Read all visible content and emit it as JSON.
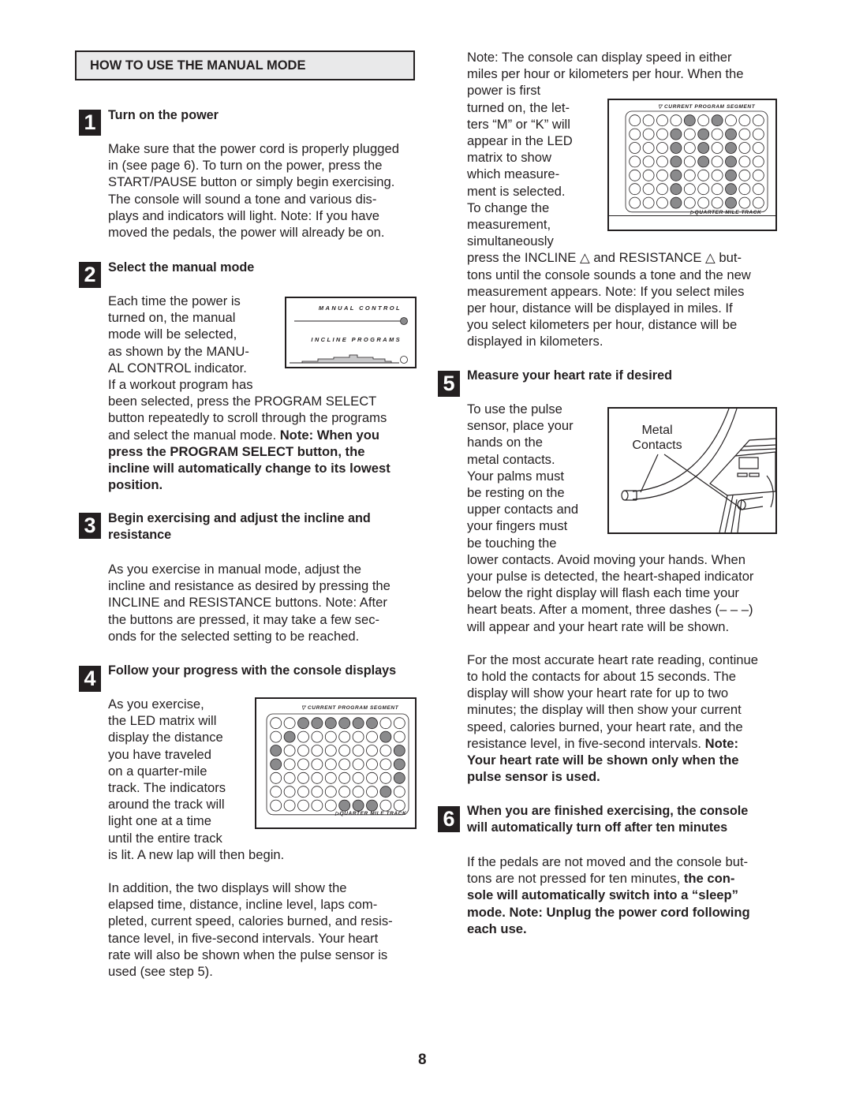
{
  "section": {
    "title": "HOW TO USE THE MANUAL MODE"
  },
  "steps": [
    {
      "number": "1",
      "heading": "Turn on the power",
      "body": [
        "Make sure that the power cord is properly plugged",
        "in (see page 6). To turn on the power, press the",
        "START/PAUSE button or simply begin exercising.",
        "The console will sound a tone and various dis-",
        "plays and indicators will light. Note: If you have",
        "moved the pedals, the power will already be on."
      ]
    },
    {
      "number": "2",
      "heading": "Select the manual mode",
      "body_wrapped": [
        "Each time the power is",
        "turned on, the manual",
        "mode will be selected,",
        "as shown by the MANU-",
        "AL CONTROL indicator.",
        "If a workout program has"
      ],
      "body": [
        "been selected, press the PROGRAM SELECT",
        "button repeatedly to scroll through the programs"
      ],
      "body_mixed_normal": "and select the manual mode. ",
      "body_mixed_bold": "Note: When you",
      "body_bold": [
        "press the PROGRAM SELECT button, the",
        "incline will automatically change to its lowest",
        "position."
      ],
      "figure": {
        "label_top": "MANUAL CONTROL",
        "label_bottom": "INCLINE PROGRAMS",
        "manual_control_lit": true,
        "incline_programs_lit": false
      }
    },
    {
      "number": "3",
      "heading": [
        "Begin exercising and adjust the incline and",
        "resistance"
      ],
      "body": [
        "As you exercise in manual mode, adjust the",
        "incline and resistance as desired by pressing the",
        "INCLINE and RESISTANCE buttons. Note: After",
        "the buttons are pressed, it may take a few sec-",
        "onds for the selected setting to be reached."
      ]
    },
    {
      "number": "4",
      "heading": "Follow your progress with the console displays",
      "body_wrapped": [
        "As you exercise,",
        "the LED matrix will",
        "display the distance",
        "you have traveled",
        "on a quarter-mile",
        "track. The indicators",
        "around the track will",
        "light one at a time",
        "until the entire track"
      ],
      "body_after": "is lit. A new lap will then begin.",
      "body2": [
        "In addition, the two displays will show the",
        "elapsed time, distance, incline level, laps com-",
        "pleted, current speed, calories burned, and resis-",
        "tance level, in five-second intervals. Your heart",
        "rate will also be shown when the pulse sensor is",
        "used (see step 5)."
      ],
      "figure": {
        "label_top": "CURRENT PROGRAM SEGMENT",
        "label_bottom": "QUARTER MILE TRACK",
        "matrix": [
          [
            0,
            0,
            1,
            1,
            1,
            1,
            1,
            1,
            0,
            0
          ],
          [
            0,
            1,
            0,
            0,
            0,
            0,
            0,
            0,
            1,
            0
          ],
          [
            1,
            0,
            0,
            0,
            0,
            0,
            0,
            0,
            0,
            1
          ],
          [
            1,
            0,
            0,
            0,
            0,
            0,
            0,
            0,
            0,
            1
          ],
          [
            0,
            0,
            0,
            0,
            0,
            0,
            0,
            0,
            0,
            1
          ],
          [
            0,
            0,
            0,
            0,
            0,
            0,
            0,
            0,
            1,
            0
          ],
          [
            0,
            0,
            0,
            0,
            0,
            1,
            1,
            1,
            0,
            0
          ]
        ]
      }
    },
    {
      "number": "5",
      "heading": "Measure your heart rate if desired",
      "body_wrapped": [
        "To use the pulse",
        "sensor, place your",
        "hands on the",
        "metal contacts.",
        "Your palms must",
        "be resting on the",
        "upper contacts and",
        "your fingers must",
        "be touching the"
      ],
      "body": [
        "lower contacts. Avoid moving your hands. When",
        "your pulse is detected, the heart-shaped indicator",
        "below the right display will flash each time your",
        "heart beats. After a moment, three dashes (– – –)",
        "will appear and your heart rate will be shown."
      ],
      "body2": [
        "For the most accurate heart rate reading, continue",
        "to hold the contacts for about 15 seconds. The",
        "display will show your heart rate for up to two",
        "minutes; the display will then show your current",
        "speed, calories burned, your heart rate, and the"
      ],
      "body2_mixed_normal": "resistance level, in five-second intervals. ",
      "body2_mixed_bold": "Note:",
      "body2_bold": [
        "Your heart rate will be shown only when the",
        "pulse sensor is used."
      ],
      "figure": {
        "label_line1": "Metal",
        "label_line2": "Contacts"
      }
    },
    {
      "number": "6",
      "heading": [
        "When you are finished exercising, the console",
        "will automatically turn off after ten minutes"
      ],
      "body": [
        "If the pedals are not moved and the console but-"
      ],
      "body_mixed_normal": "tons are not pressed for ten minutes, ",
      "body_mixed_bold": "the con-",
      "body_bold": [
        "sole will automatically switch into a “sleep”",
        "mode. Note: Unplug the power cord following",
        "each use."
      ]
    }
  ],
  "right_note": {
    "lines_full": [
      "Note: The console can display speed in either",
      "miles per hour or kilometers per hour. When the"
    ],
    "lines_wrapped": [
      "power is first",
      "turned on, the let-",
      "ters “M” or “K” will",
      "appear in the LED",
      "matrix to show",
      "which measure-",
      "ment is selected.",
      "To change the",
      "measurement,",
      "simultaneously"
    ],
    "lines_after": [
      "press the INCLINE △ and RESISTANCE △ but-",
      "tons until the console sounds a tone and the new",
      "measurement appears. Note: If you select miles",
      "per hour, distance will be displayed in miles. If",
      "you select kilometers per hour, distance will be",
      "displayed in kilometers."
    ],
    "figure": {
      "label_top": "CURRENT PROGRAM SEGMENT",
      "label_bottom": "QUARTER MILE TRACK",
      "matrix": [
        [
          0,
          0,
          0,
          0,
          1,
          0,
          1,
          0,
          0,
          0
        ],
        [
          0,
          0,
          0,
          1,
          0,
          1,
          0,
          1,
          0,
          0
        ],
        [
          0,
          0,
          0,
          1,
          0,
          1,
          0,
          1,
          0,
          0
        ],
        [
          0,
          0,
          0,
          1,
          0,
          1,
          0,
          1,
          0,
          0
        ],
        [
          0,
          0,
          0,
          1,
          0,
          0,
          0,
          1,
          0,
          0
        ],
        [
          0,
          0,
          0,
          1,
          0,
          0,
          0,
          1,
          0,
          0
        ],
        [
          0,
          0,
          0,
          1,
          0,
          0,
          0,
          1,
          0,
          0
        ]
      ]
    }
  },
  "page_number": "8",
  "colors": {
    "text": "#231f20",
    "led_on": "#8a8a8c",
    "section_bg": "#e9e9ea"
  }
}
